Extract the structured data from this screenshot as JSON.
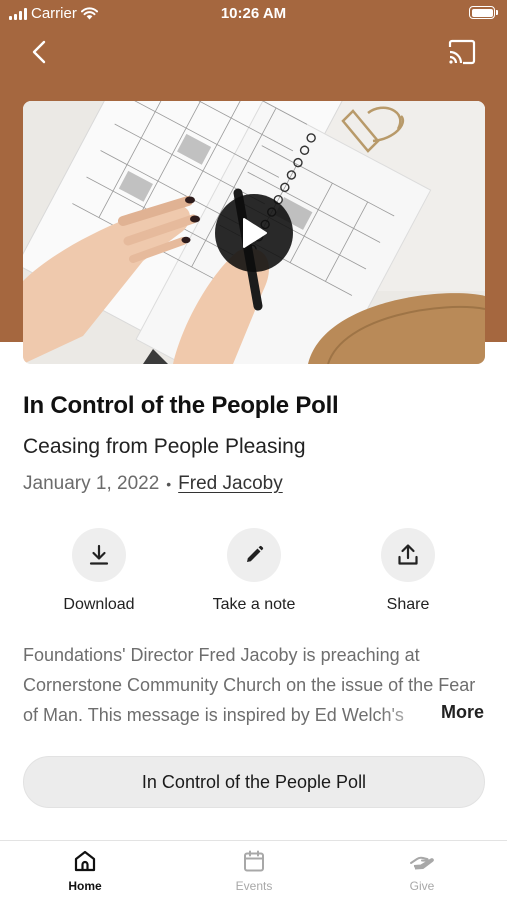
{
  "status_bar": {
    "carrier": "Carrier",
    "time": "10:26 AM"
  },
  "header": {
    "back_icon": "chevron-left-icon",
    "cast_icon": "cast-icon",
    "background_color": "#a5673f"
  },
  "media": {
    "play_icon": "play-icon"
  },
  "sermon": {
    "title": "In Control of the People Poll",
    "subtitle": "Ceasing from People Pleasing",
    "date": "January 1, 2022",
    "separator": "•",
    "speaker": "Fred Jacoby"
  },
  "actions": [
    {
      "label": "Download",
      "icon": "download-icon"
    },
    {
      "label": "Take a note",
      "icon": "pencil-icon"
    },
    {
      "label": "Share",
      "icon": "share-icon"
    }
  ],
  "description": {
    "text": "Foundations' Director Fred Jacoby is preaching at Cornerstone Community Church on the issue of the Fear of Man.  This message is inspired by Ed Welch's",
    "more_label": "More"
  },
  "series_button": {
    "label": "In Control of the People Poll"
  },
  "tabs": [
    {
      "label": "Home",
      "icon": "home-icon",
      "active": true
    },
    {
      "label": "Events",
      "icon": "calendar-icon",
      "active": false
    },
    {
      "label": "Give",
      "icon": "give-icon",
      "active": false
    }
  ]
}
